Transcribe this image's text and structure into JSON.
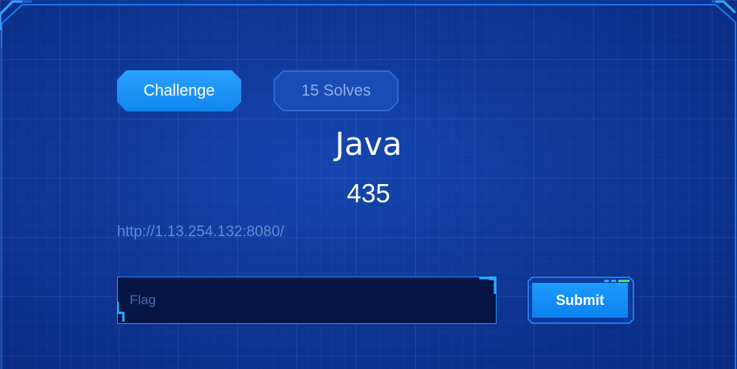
{
  "tabs": {
    "challenge_label": "Challenge",
    "solves_label": "15 Solves"
  },
  "challenge": {
    "title": "Java",
    "points": "435",
    "link": "http://1.13.254.132:8080/"
  },
  "flag_form": {
    "placeholder": "Flag",
    "submit_label": "Submit"
  },
  "colors": {
    "accent": "#1a8cff",
    "background": "#0c3390",
    "input_bg": "#051645",
    "frame_line": "#2a8cff"
  }
}
